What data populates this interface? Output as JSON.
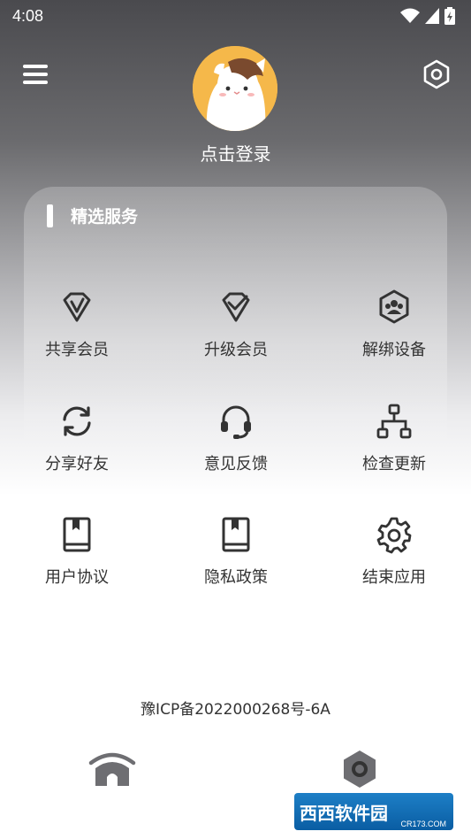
{
  "status_bar": {
    "time": "4:08",
    "icons": [
      "wifi-icon",
      "signal-icon",
      "battery-icon"
    ]
  },
  "header": {
    "menu_icon": "menu-icon",
    "settings_icon": "hexagon-settings-icon",
    "login_label": "点击登录"
  },
  "services": {
    "title": "精选服务",
    "items": [
      {
        "label": "共享会员",
        "icon": "vip-diamond-icon"
      },
      {
        "label": "升级会员",
        "icon": "diamond-check-icon"
      },
      {
        "label": "解绑设备",
        "icon": "device-users-icon"
      },
      {
        "label": "分享好友",
        "icon": "refresh-icon"
      },
      {
        "label": "意见反馈",
        "icon": "headset-icon"
      },
      {
        "label": "检查更新",
        "icon": "hierarchy-icon"
      },
      {
        "label": "用户协议",
        "icon": "book-icon"
      },
      {
        "label": "隐私政策",
        "icon": "book-icon"
      },
      {
        "label": "结束应用",
        "icon": "gear-icon"
      }
    ]
  },
  "footer": {
    "icp": "豫ICP备2022000268号-6A"
  },
  "bottom_nav": {
    "home_icon": "home-icon",
    "settings_icon": "hexagon-settings-icon"
  },
  "watermark": {
    "text": "西西软件园",
    "sub": "CR173.COM"
  },
  "colors": {
    "icon": "#333333",
    "nav_icon": "#6e6e72"
  }
}
